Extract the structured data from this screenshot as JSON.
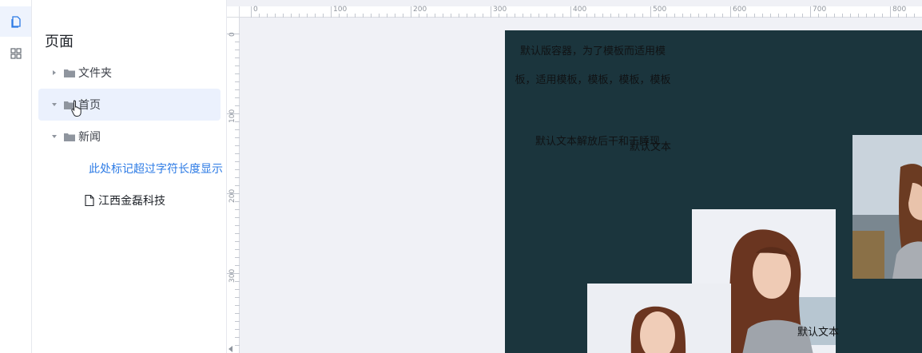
{
  "rail": {
    "items": [
      "page-icon",
      "grid-icon"
    ]
  },
  "panel": {
    "title": "页面",
    "tree": [
      {
        "label": "文件夹",
        "type": "folder",
        "expanded": false
      },
      {
        "label": "首页",
        "type": "folder",
        "expanded": true,
        "selected": true
      },
      {
        "label": "新闻",
        "type": "folder",
        "expanded": true
      },
      {
        "label": "此处标记超过字符长度显示",
        "type": "file",
        "link": true
      },
      {
        "label": "江西金磊科技",
        "type": "file"
      }
    ]
  },
  "ruler": {
    "top": [
      "0",
      "100",
      "200",
      "300",
      "400",
      "500",
      "600",
      "700",
      "800"
    ],
    "left": [
      "0",
      "100",
      "200",
      "300"
    ]
  },
  "board": {
    "container_text": "默认版容器，为了模板而适用模板，适用模板，模板，模板，模板",
    "text_a": "默认文本解放后干和于睡现",
    "text_b": "默认文本",
    "text_c": "默认文本",
    "colors": {
      "board_bg": "#1b353d",
      "canvas_bg": "#f0f1f6",
      "accent": "#2d7be5"
    }
  }
}
